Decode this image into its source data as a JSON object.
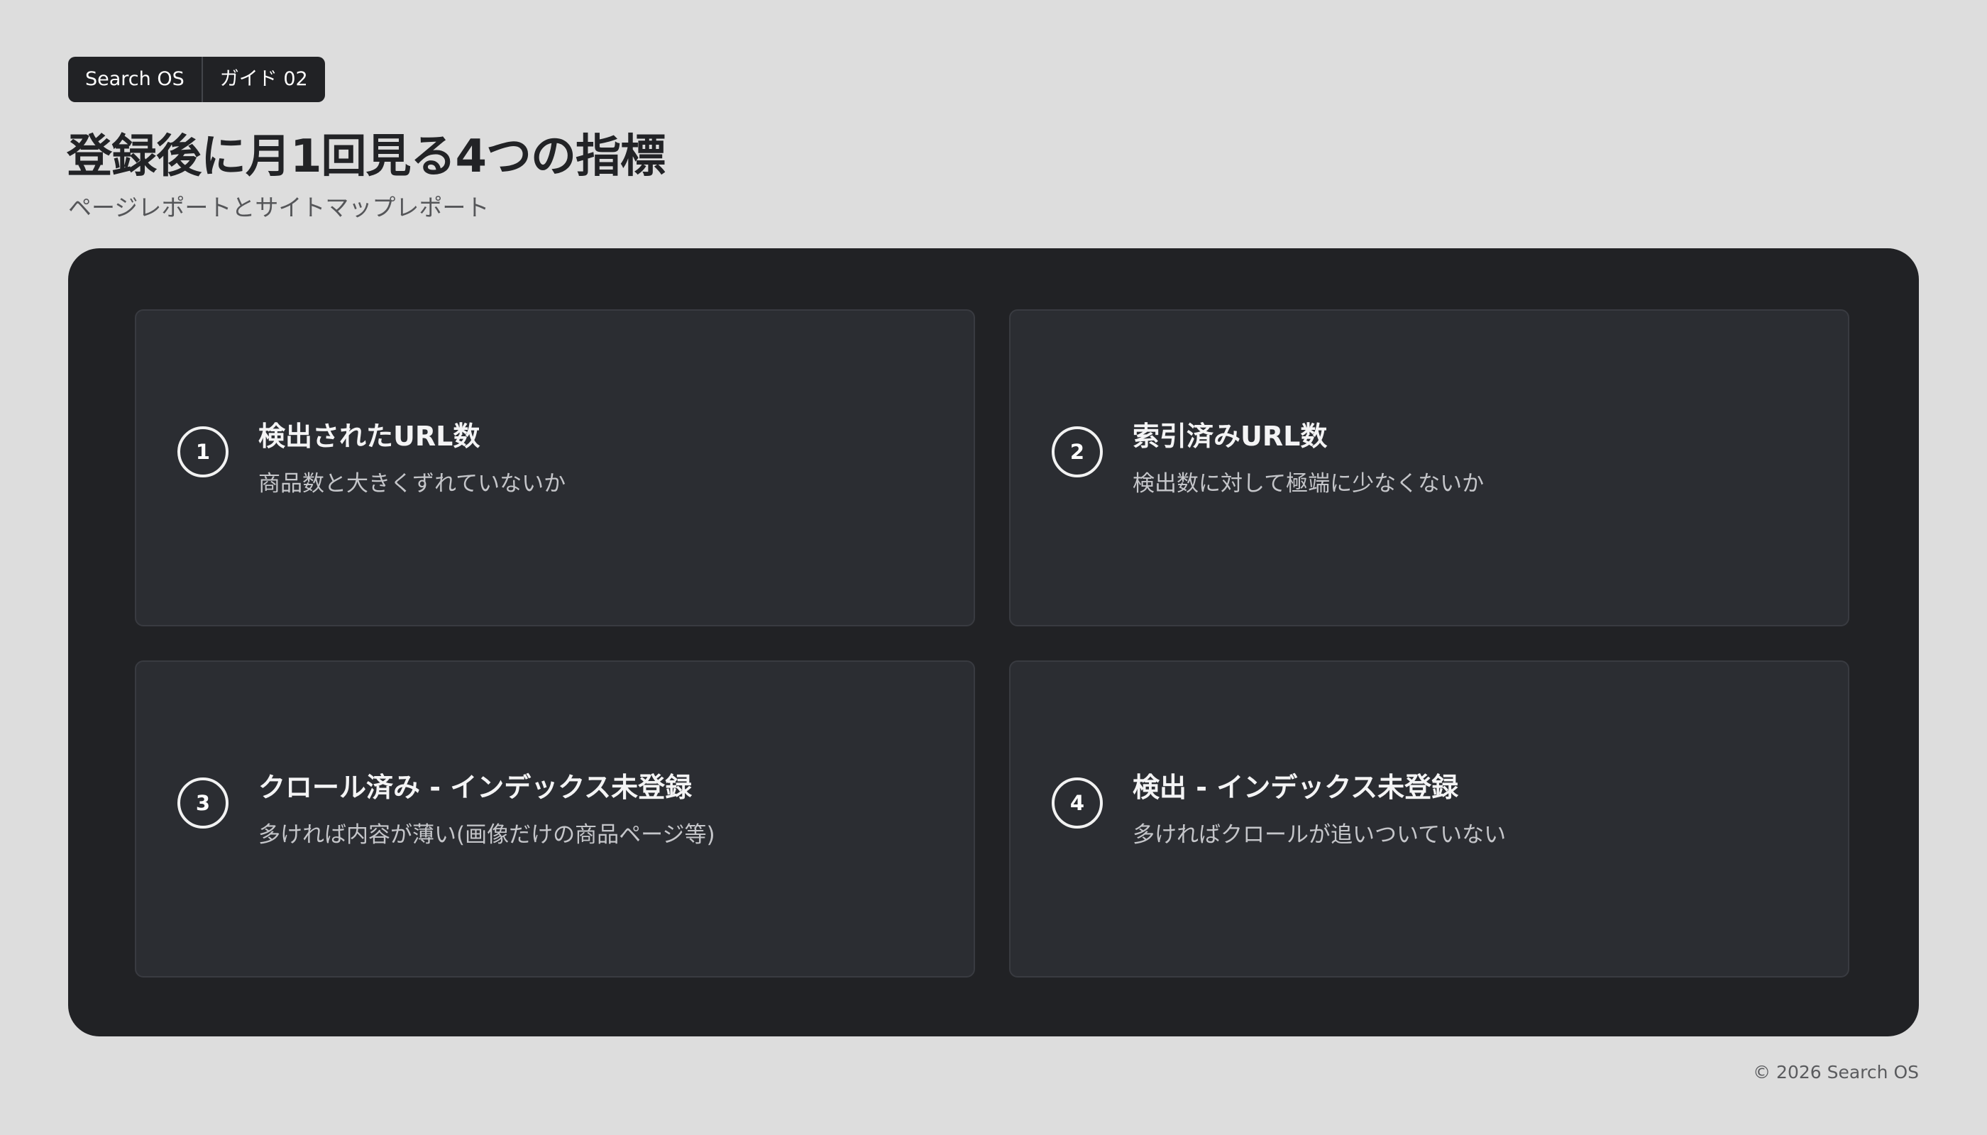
{
  "header": {
    "badge_brand": "Search OS",
    "badge_guide": "ガイド 02",
    "title": "登録後に月1回見る4つの指標",
    "subtitle": "ページレポートとサイトマップレポート"
  },
  "metrics": [
    {
      "number": "1",
      "title": "検出されたURL数",
      "description": "商品数と大きくずれていないか"
    },
    {
      "number": "2",
      "title": "索引済みURL数",
      "description": "検出数に対して極端に少なくないか"
    },
    {
      "number": "3",
      "title": "クロール済み - インデックス未登録",
      "description": "多ければ内容が薄い(画像だけの商品ページ等)"
    },
    {
      "number": "4",
      "title": "検出 - インデックス未登録",
      "description": "多ければクロールが追いついていない"
    }
  ],
  "footer": {
    "copyright": "© 2026 Search OS"
  }
}
